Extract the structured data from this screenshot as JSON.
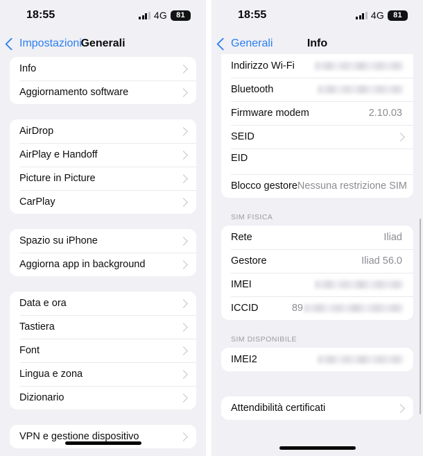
{
  "left": {
    "status": {
      "time": "18:55",
      "network": "4G",
      "battery": "81",
      "signal_icon": "signal-bars-icon",
      "battery_icon": "battery-icon"
    },
    "nav": {
      "back_label": "Impostazioni",
      "title": "Generali",
      "back_icon": "chevron-left-icon"
    },
    "groups": [
      {
        "rows": [
          {
            "label": "Info",
            "chevron": true
          },
          {
            "label": "Aggiornamento software",
            "chevron": true
          }
        ]
      },
      {
        "rows": [
          {
            "label": "AirDrop",
            "chevron": true
          },
          {
            "label": "AirPlay e Handoff",
            "chevron": true
          },
          {
            "label": "Picture in Picture",
            "chevron": true
          },
          {
            "label": "CarPlay",
            "chevron": true
          }
        ]
      },
      {
        "rows": [
          {
            "label": "Spazio su iPhone",
            "chevron": true
          },
          {
            "label": "Aggiorna app in background",
            "chevron": true
          }
        ]
      },
      {
        "rows": [
          {
            "label": "Data e ora",
            "chevron": true
          },
          {
            "label": "Tastiera",
            "chevron": true
          },
          {
            "label": "Font",
            "chevron": true
          },
          {
            "label": "Lingua e zona",
            "chevron": true
          },
          {
            "label": "Dizionario",
            "chevron": true
          }
        ]
      },
      {
        "rows": [
          {
            "label": "VPN e gestione dispositivo",
            "chevron": true
          }
        ]
      }
    ]
  },
  "right": {
    "status": {
      "time": "18:55",
      "network": "4G",
      "battery": "81",
      "signal_icon": "signal-bars-icon",
      "battery_icon": "battery-icon"
    },
    "nav": {
      "back_label": "Generali",
      "title": "Info",
      "back_icon": "chevron-left-icon"
    },
    "group1": {
      "rows": [
        {
          "label": "Indirizzo Wi-Fi",
          "value": "",
          "redacted": true
        },
        {
          "label": "Bluetooth",
          "value": "",
          "redacted": true
        },
        {
          "label": "Firmware modem",
          "value": "2.10.03",
          "redacted": false
        },
        {
          "label": "SEID",
          "value": "",
          "chevron": true
        },
        {
          "label": "EID",
          "value": "",
          "redacted": true,
          "two_line": true
        },
        {
          "label": "Blocco gestore",
          "value": "Nessuna restrizione SIM",
          "redacted": false
        }
      ]
    },
    "sim_fisica": {
      "section_label": "SIM FISICA",
      "rows": [
        {
          "label": "Rete",
          "value": "Iliad",
          "redacted": false
        },
        {
          "label": "Gestore",
          "value": "Iliad 56.0",
          "redacted": false
        },
        {
          "label": "IMEI",
          "value": "",
          "redacted": true
        },
        {
          "label": "ICCID",
          "value": "89",
          "redacted": true
        }
      ]
    },
    "sim_disponibile": {
      "section_label": "SIM DISPONIBILE",
      "rows": [
        {
          "label": "IMEI2",
          "value": "",
          "redacted": true
        }
      ]
    },
    "certificates": {
      "rows": [
        {
          "label": "Attendibilità certificati",
          "chevron": true
        }
      ]
    }
  }
}
